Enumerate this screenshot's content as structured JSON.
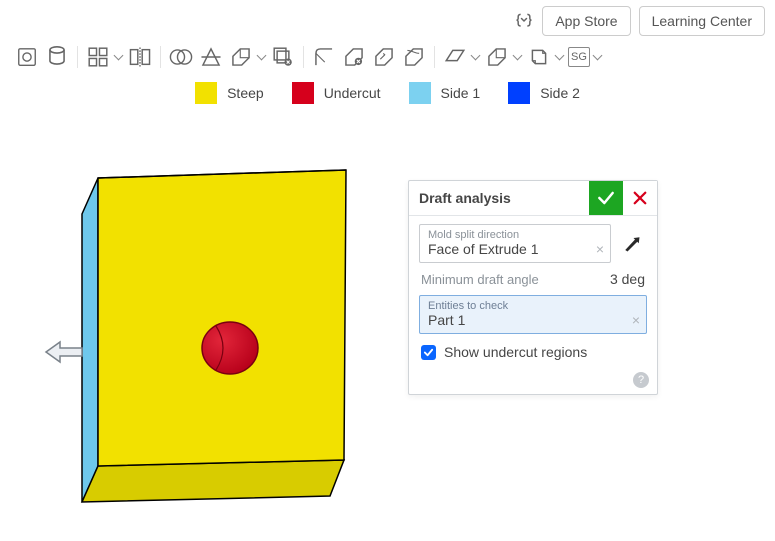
{
  "header": {
    "app_store_label": "App Store",
    "learning_center_label": "Learning Center"
  },
  "toolbar": {
    "sg_label": "SG"
  },
  "legend": {
    "steep": {
      "label": "Steep",
      "color": "#f2e100"
    },
    "undercut": {
      "label": "Undercut",
      "color": "#d6001c"
    },
    "side1": {
      "label": "Side 1",
      "color": "#7cd1f0"
    },
    "side2": {
      "label": "Side 2",
      "color": "#0040ff"
    }
  },
  "panel": {
    "title": "Draft analysis",
    "mold_split_label": "Mold split direction",
    "mold_split_value": "Face of Extrude 1",
    "min_draft_label": "Minimum draft angle",
    "min_draft_value": "3 deg",
    "entities_label": "Entities to check",
    "entities_value": "Part 1",
    "show_undercut_label": "Show undercut regions",
    "show_undercut_checked": true,
    "help_char": "?"
  }
}
